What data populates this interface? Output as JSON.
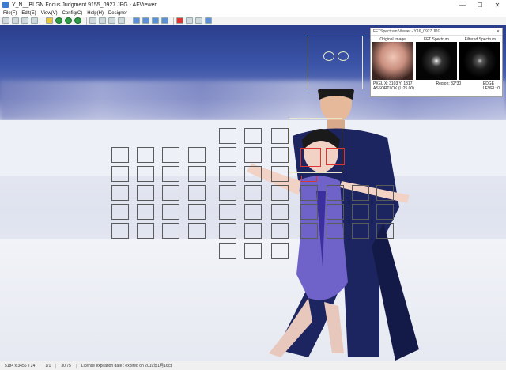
{
  "window": {
    "title": "Y_N__BLGN Focus Judgment 9155_0927.JPG - AFViewer",
    "controls": [
      "—",
      "☐",
      "✕"
    ]
  },
  "menu": [
    "File(F)",
    "Edit(E)",
    "View(V)",
    "Config(C)",
    "Help(H)",
    "Designer"
  ],
  "toolbar": {
    "buttons": [
      "open-icon",
      "grid-icon",
      "list-icon",
      "panel-icon",
      "folder-icon",
      "back-icon",
      "forward-icon",
      "refresh-icon",
      "zoom-icon",
      "fit-icon",
      "compare-icon",
      "crop-icon",
      "rotate-left-icon",
      "rotate-right-icon",
      "flip-icon",
      "mirror-icon",
      "delete-icon",
      "info-icon",
      "person-icon",
      "settings-icon"
    ]
  },
  "fft_viewer": {
    "title": "FFTSpectrum Viewer - Y16_0927.JPG",
    "panels": [
      {
        "label": "Original Image"
      },
      {
        "label": "FFT Spectrum"
      },
      {
        "label": "Filtered Spectrum"
      }
    ],
    "readout_left": "PXEL X: 3103 Y: 1317",
    "readout_left2": "ASSORTLOK (L:25.00)",
    "readout_mid": "Region: 32*30",
    "readout_right": "EDGE",
    "readout_right2": "LEVEL: 0"
  },
  "status": {
    "dimensions": "5184 x 3456 x 24",
    "page": "1/1",
    "zoom": "30.75",
    "license": "License expiration date : expired on 2019年1月16日"
  }
}
